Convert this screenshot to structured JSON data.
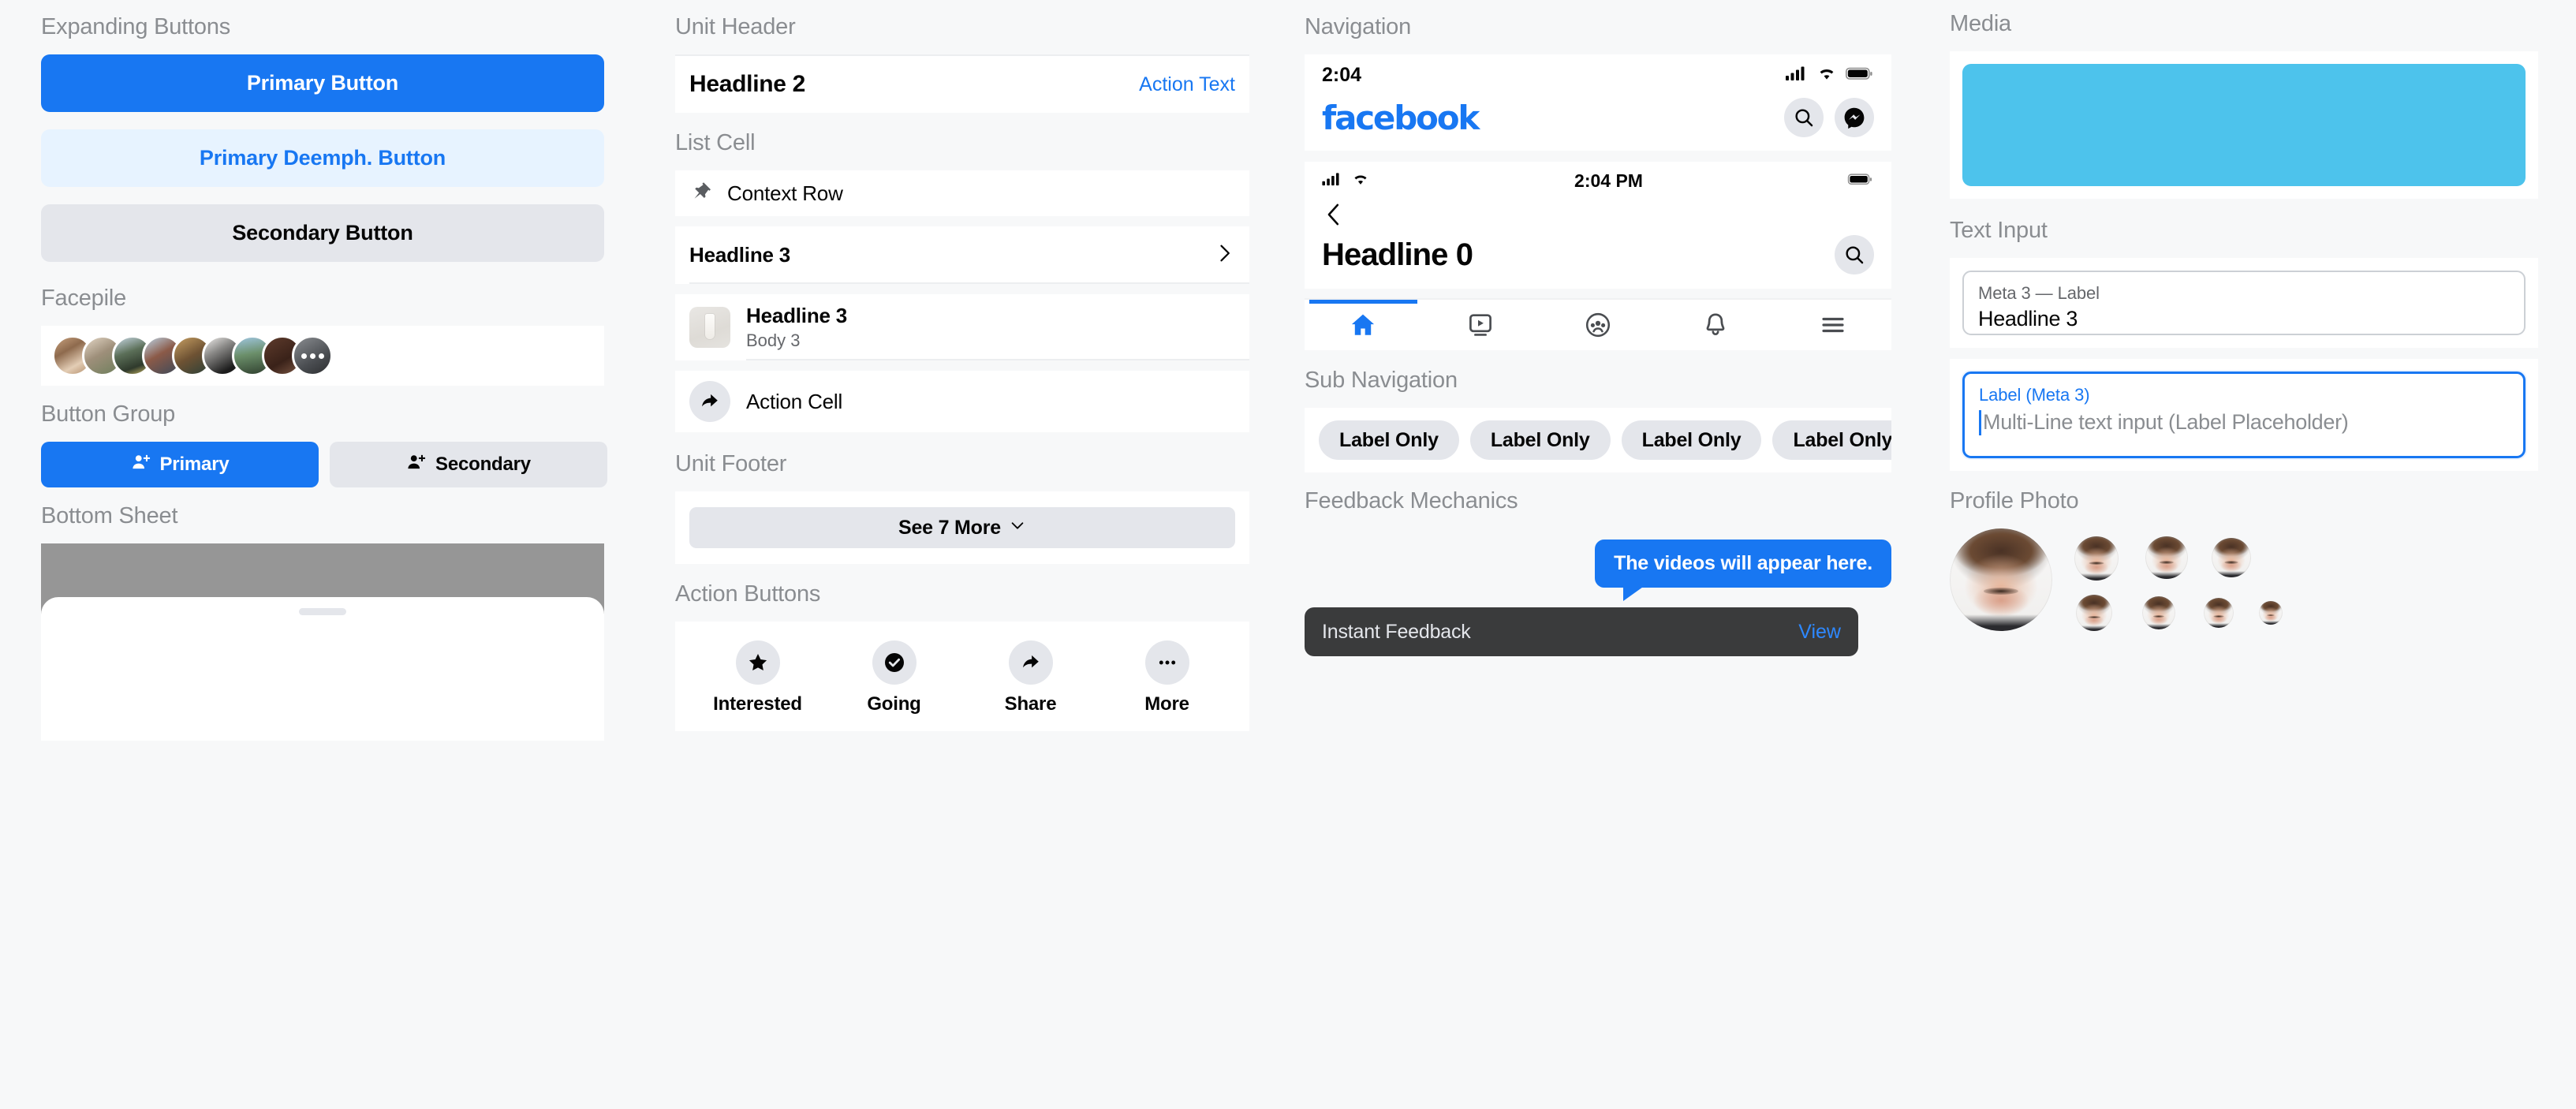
{
  "columns": {
    "one": {
      "expanding_buttons": {
        "title": "Expanding Buttons",
        "primary": "Primary Button",
        "deemph": "Primary Deemph. Button",
        "secondary": "Secondary Button"
      },
      "facepile": {
        "title": "Facepile",
        "count": 9
      },
      "button_group": {
        "title": "Button Group",
        "primary": "Primary",
        "secondary": "Secondary",
        "icon": "add-friend-icon"
      },
      "bottom_sheet": {
        "title": "Bottom Sheet"
      }
    },
    "two": {
      "unit_header": {
        "title": "Unit Header",
        "headline": "Headline 2",
        "action": "Action Text"
      },
      "list_cell": {
        "title": "List Cell",
        "context_row": {
          "label": "Context Row",
          "icon": "pin-icon"
        },
        "chevron_row": {
          "label": "Headline 3",
          "icon": "chevron-right-icon"
        },
        "media_row": {
          "headline": "Headline 3",
          "body": "Body 3",
          "icon": "thumbnail-image"
        },
        "action_row": {
          "label": "Action Cell",
          "icon": "share-icon"
        }
      },
      "unit_footer": {
        "title": "Unit Footer",
        "see_more": "See 7 More",
        "icon": "chevron-down-icon"
      },
      "action_buttons": {
        "title": "Action Buttons",
        "items": [
          {
            "label": "Interested",
            "icon": "star-icon"
          },
          {
            "label": "Going",
            "icon": "check-circle-icon"
          },
          {
            "label": "Share",
            "icon": "share-icon"
          },
          {
            "label": "More",
            "icon": "ellipsis-icon"
          }
        ]
      }
    },
    "three": {
      "navigation": {
        "title": "Navigation",
        "status_bar": {
          "time": "2:04",
          "icons": [
            "cellular-icon",
            "wifi-icon",
            "battery-icon"
          ]
        },
        "brand": "facebook",
        "actions": [
          {
            "icon": "search-icon"
          },
          {
            "icon": "messenger-icon"
          }
        ],
        "status_bar_2": {
          "time": "2:04 PM",
          "icons": [
            "cellular-icon",
            "wifi-icon",
            "battery-icon"
          ]
        },
        "back_icon": "chevron-left-icon",
        "headline": "Headline 0",
        "search_icon": "search-icon",
        "tabs": [
          {
            "icon": "home-icon",
            "active": true
          },
          {
            "icon": "video-icon",
            "active": false
          },
          {
            "icon": "groups-icon",
            "active": false
          },
          {
            "icon": "bell-icon",
            "active": false
          },
          {
            "icon": "menu-icon",
            "active": false
          }
        ]
      },
      "sub_navigation": {
        "title": "Sub Navigation",
        "pills": [
          "Label Only",
          "Label Only",
          "Label Only",
          "Label Only"
        ]
      },
      "feedback": {
        "title": "Feedback Mechanics",
        "tooltip": "The videos will appear here.",
        "toast_message": "Instant Feedback",
        "toast_action": "View"
      }
    },
    "four": {
      "media": {
        "title": "Media",
        "color": "#4dc3ec"
      },
      "text_input": {
        "title": "Text Input",
        "field_one": {
          "label": "Meta 3 — Label",
          "value": "Headline 3"
        },
        "field_two": {
          "label": "Label (Meta 3)",
          "placeholder": "Multi-Line text input (Label Placeholder)"
        }
      },
      "profile_photo": {
        "title": "Profile Photo"
      }
    }
  },
  "colors": {
    "accent_blue": "#1877f2",
    "deemph_blue_bg": "#e7f3ff",
    "secondary_gray": "#e4e6eb",
    "page_bg": "#f7f8f9",
    "toast_bg": "#3a3b3c",
    "media_cyan": "#4dc3ec",
    "muted_text": "#8a8d91"
  }
}
